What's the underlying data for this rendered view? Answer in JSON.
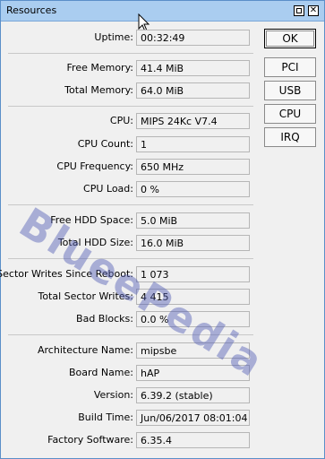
{
  "window": {
    "title": "Resources",
    "restore_icon": "restore-icon",
    "close_glyph": "✕"
  },
  "fields": {
    "uptime": {
      "label": "Uptime:",
      "value": "00:32:49"
    },
    "free_memory": {
      "label": "Free Memory:",
      "value": "41.4 MiB"
    },
    "total_memory": {
      "label": "Total Memory:",
      "value": "64.0 MiB"
    },
    "cpu": {
      "label": "CPU:",
      "value": "MIPS 24Kc V7.4"
    },
    "cpu_count": {
      "label": "CPU Count:",
      "value": "1"
    },
    "cpu_frequency": {
      "label": "CPU Frequency:",
      "value": "650 MHz"
    },
    "cpu_load": {
      "label": "CPU Load:",
      "value": "0 %"
    },
    "free_hdd": {
      "label": "Free HDD Space:",
      "value": "5.0 MiB"
    },
    "total_hdd": {
      "label": "Total HDD Size:",
      "value": "16.0 MiB"
    },
    "sector_writes_since_reboot": {
      "label": "Sector Writes Since Reboot:",
      "value": "1 073"
    },
    "total_sector_writes": {
      "label": "Total Sector Writes:",
      "value": "4 415"
    },
    "bad_blocks": {
      "label": "Bad Blocks:",
      "value": "0.0 %"
    },
    "architecture": {
      "label": "Architecture Name:",
      "value": "mipsbe"
    },
    "board_name": {
      "label": "Board Name:",
      "value": "hAP"
    },
    "version": {
      "label": "Version:",
      "value": "6.39.2 (stable)"
    },
    "build_time": {
      "label": "Build Time:",
      "value": "Jun/06/2017 08:01:04"
    },
    "factory_software": {
      "label": "Factory Software:",
      "value": "6.35.4"
    }
  },
  "buttons": {
    "ok": "OK",
    "pci": "PCI",
    "usb": "USB",
    "cpu": "CPU",
    "irq": "IRQ"
  },
  "watermark": "BlueePedia",
  "colors": {
    "titlebar": "#aacdf0",
    "window_border": "#5b8fc9",
    "watermark": "#5a64b4"
  }
}
